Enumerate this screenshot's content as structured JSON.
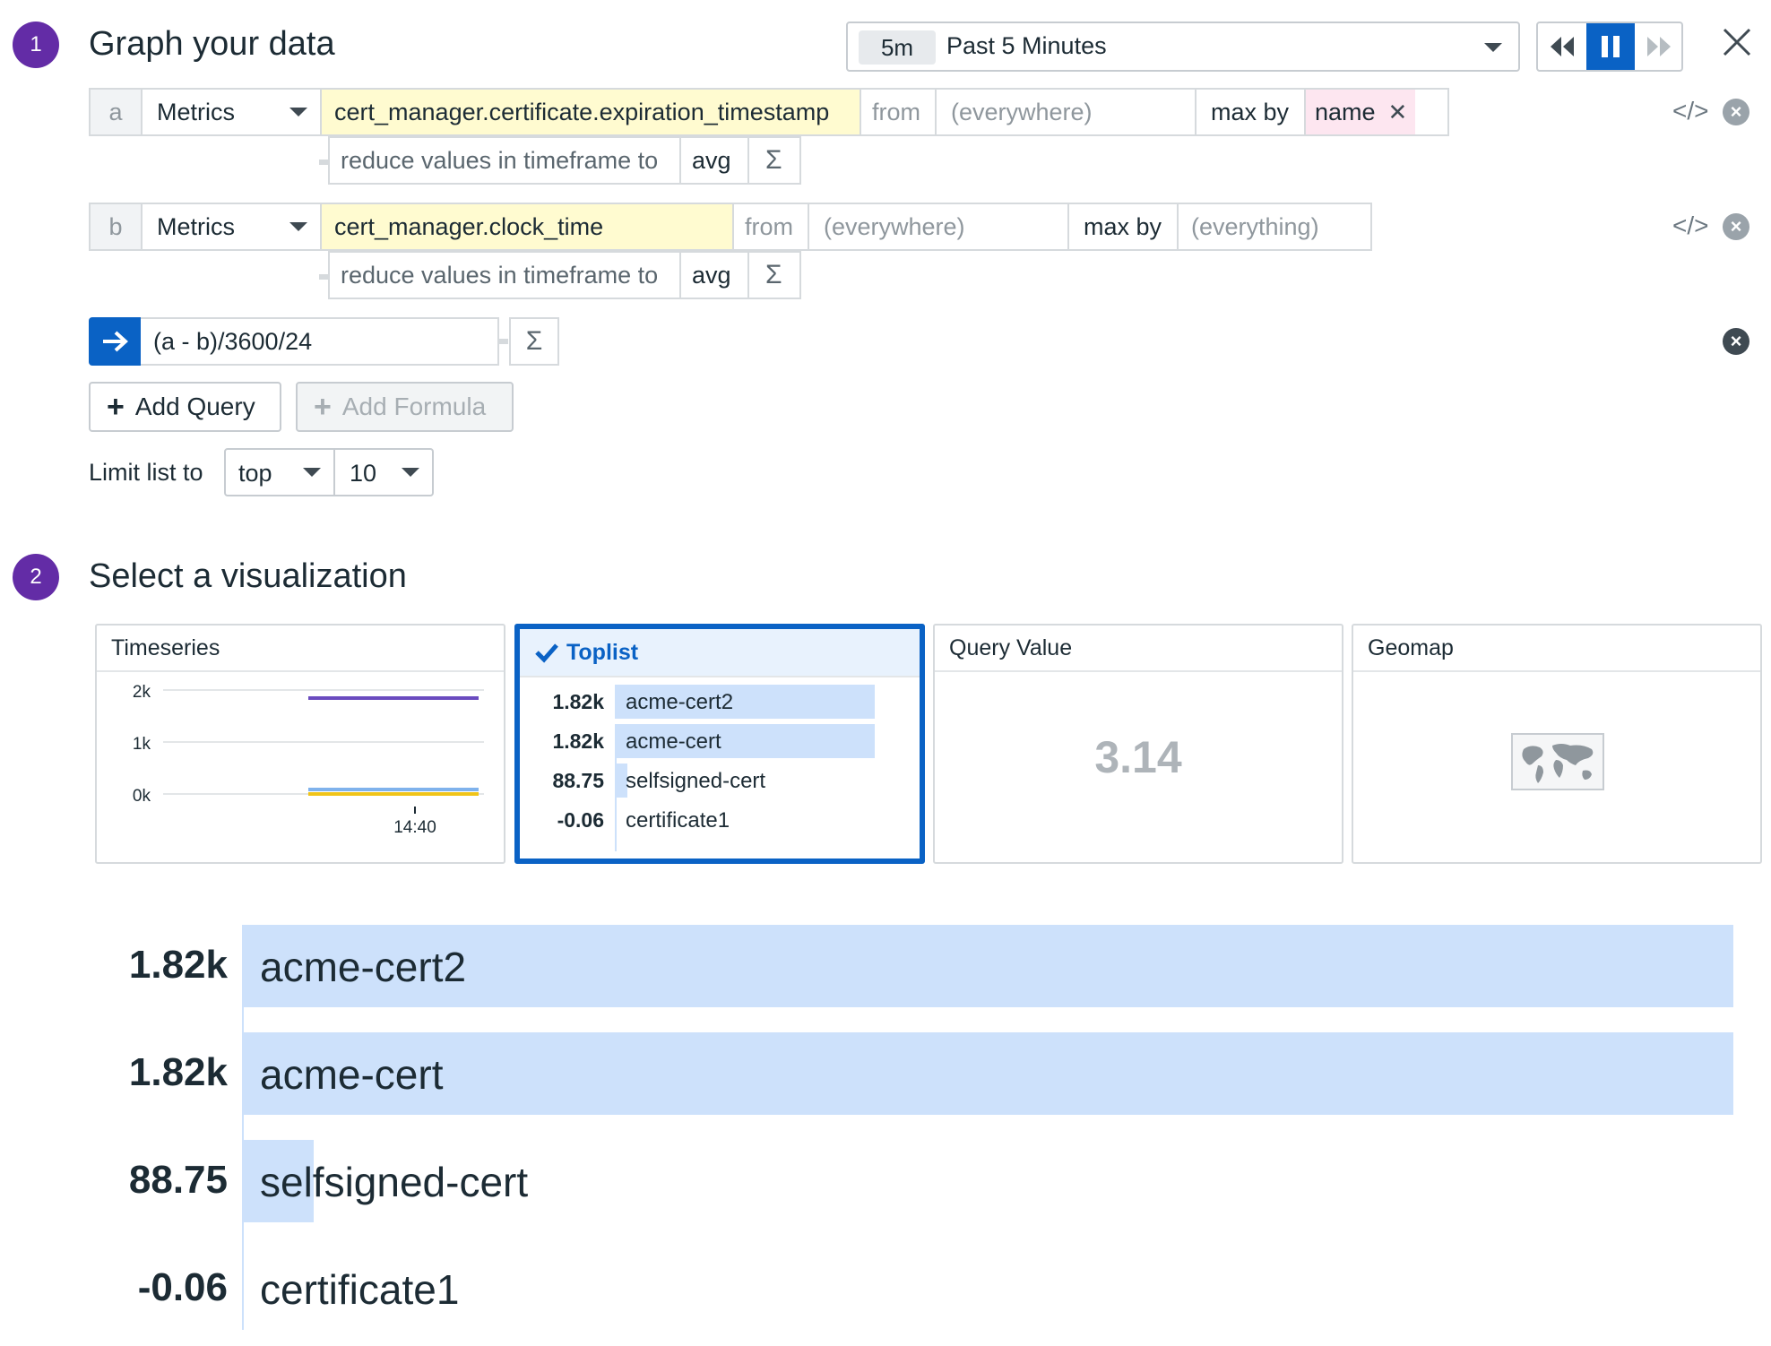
{
  "section1": {
    "step": "1",
    "title": "Graph your data"
  },
  "timeframe": {
    "short": "5m",
    "label": "Past 5 Minutes"
  },
  "playback": {
    "rewind_icon": "rewind-icon",
    "pause_icon": "pause-icon",
    "forward_icon": "fast-forward-icon"
  },
  "queries": [
    {
      "letter": "a",
      "source": "Metrics",
      "metric": "cert_manager.certificate.expiration_timestamp",
      "from_label": "from",
      "from_value": "(everywhere)",
      "agg_label": "max by",
      "agg_value": "name"
    },
    {
      "letter": "b",
      "source": "Metrics",
      "metric": "cert_manager.clock_time",
      "from_label": "from",
      "from_value": "(everywhere)",
      "agg_label": "max by",
      "agg_value": "(everything)"
    }
  ],
  "reduce": {
    "label": "reduce values in timeframe to",
    "func": "avg",
    "sigma": "Σ"
  },
  "formula": {
    "expression": "(a - b)/3600/24",
    "sigma": "Σ"
  },
  "buttons": {
    "add_query": "Add Query",
    "add_formula": "Add Formula",
    "code_toggle": "</>"
  },
  "limit": {
    "label": "Limit list to",
    "order": "top",
    "count": "10"
  },
  "section2": {
    "step": "2",
    "title": "Select a visualization"
  },
  "visualizations": {
    "timeseries": {
      "title": "Timeseries",
      "y_ticks": [
        "2k",
        "1k",
        "0k"
      ],
      "x_tick": "14:40",
      "series_colors": [
        "#6a4bbf",
        "#7fb2ec",
        "#f0c419"
      ]
    },
    "toplist": {
      "title": "Toplist",
      "rows": [
        {
          "value": "1.82k",
          "name": "acme-cert2"
        },
        {
          "value": "1.82k",
          "name": "acme-cert"
        },
        {
          "value": "88.75",
          "name": "selfsigned-cert"
        },
        {
          "value": "-0.06",
          "name": "certificate1"
        }
      ]
    },
    "query_value": {
      "title": "Query Value",
      "value": "3.14"
    },
    "geomap": {
      "title": "Geomap"
    }
  },
  "chart_data": {
    "type": "bar",
    "orientation": "horizontal",
    "categories": [
      "acme-cert2",
      "acme-cert",
      "selfsigned-cert",
      "certificate1"
    ],
    "values": [
      1820,
      1820,
      88.75,
      -0.06
    ],
    "labels": [
      "1.82k",
      "1.82k",
      "88.75",
      "-0.06"
    ],
    "bar_color": "#cde1fb"
  }
}
